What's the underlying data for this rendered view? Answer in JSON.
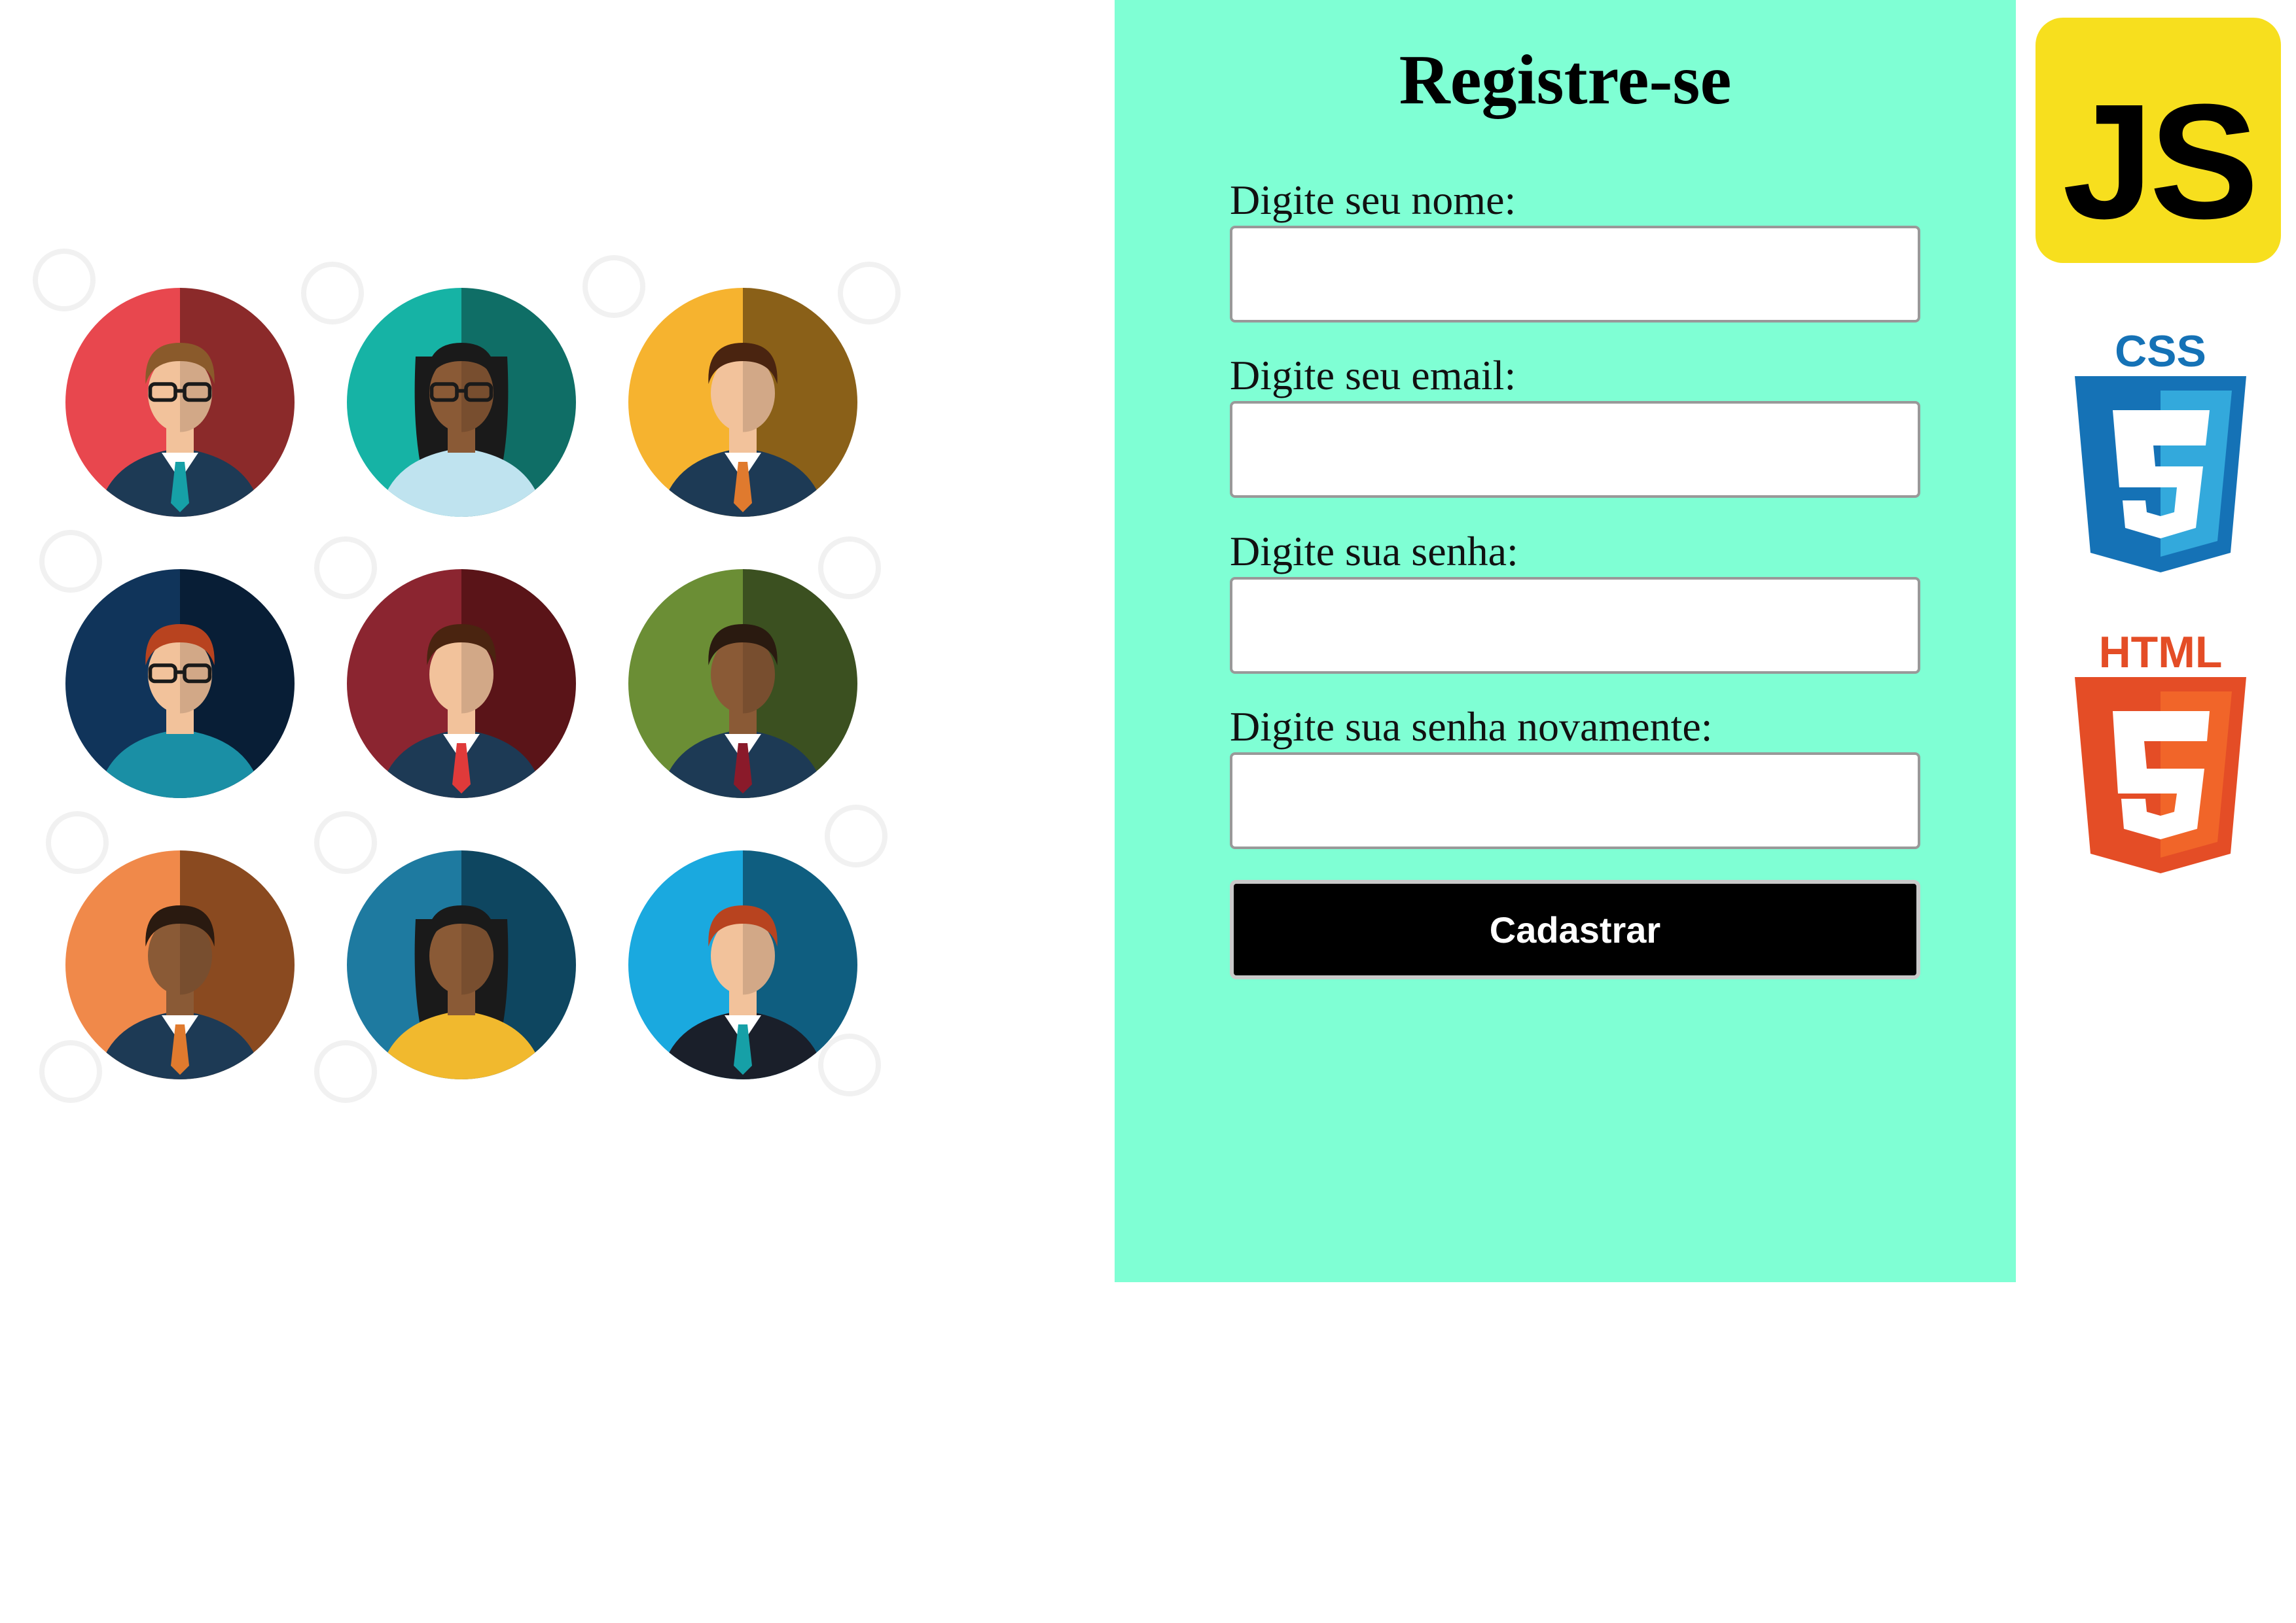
{
  "form": {
    "title": "Registre-se",
    "fields": [
      {
        "label": "Digite seu nome:",
        "value": ""
      },
      {
        "label": "Digite seu email:",
        "value": ""
      },
      {
        "label": "Digite sua senha:",
        "value": ""
      },
      {
        "label": "Digite sua senha novamente:",
        "value": ""
      }
    ],
    "submit_label": "Cadastrar"
  },
  "logos": {
    "js": "JS",
    "css": "CSS",
    "html": "HTML"
  },
  "colors": {
    "panel_bg": "#7fffd4",
    "button_bg": "#000000",
    "js_yellow": "#f7df1e",
    "css_blue": "#1572b6",
    "css_blue_light": "#33a9dc",
    "html_orange": "#e44d26",
    "html_orange_light": "#f16529"
  },
  "avatars": [
    {
      "icon": "man-glasses-avatar-icon",
      "bg": "#e8474e",
      "bg_dark": "#8b2a2a",
      "hair": "#8a5a2b",
      "top": "#1d3a55",
      "tie": "#16a0a7",
      "skin": "#f2c29b",
      "glasses": true,
      "long_hair": false
    },
    {
      "icon": "woman-glasses-avatar-icon",
      "bg": "#16b3a5",
      "bg_dark": "#0f6e66",
      "hair": "#1a1a1a",
      "top": "#bfe3ef",
      "tie": "",
      "skin": "#8a5a36",
      "glasses": true,
      "long_hair": true
    },
    {
      "icon": "man-avatar-icon",
      "bg": "#f6b32f",
      "bg_dark": "#8a6018",
      "hair": "#4a2410",
      "top": "#1d3a55",
      "tie": "#e07a2e",
      "skin": "#f2c29b",
      "glasses": false,
      "long_hair": false
    },
    {
      "icon": "woman-glasses-avatar-icon",
      "bg": "#10345a",
      "bg_dark": "#081e36",
      "hair": "#b8431f",
      "top": "#1a8fa5",
      "tie": "",
      "skin": "#f2c29b",
      "glasses": true,
      "long_hair": false
    },
    {
      "icon": "man-avatar-icon",
      "bg": "#8b2530",
      "bg_dark": "#5a1418",
      "hair": "#4a2410",
      "top": "#1d3a55",
      "tie": "#e03a3a",
      "skin": "#f2c29b",
      "glasses": false,
      "long_hair": false
    },
    {
      "icon": "man-avatar-icon",
      "bg": "#6b8e35",
      "bg_dark": "#3b5020",
      "hair": "#2a1a10",
      "top": "#1d3a55",
      "tie": "#8a1a2a",
      "skin": "#8a5a36",
      "glasses": false,
      "long_hair": false
    },
    {
      "icon": "man-avatar-icon",
      "bg": "#f0894a",
      "bg_dark": "#8a4a20",
      "hair": "#2a1a10",
      "top": "#1d3a55",
      "tie": "#e07a2e",
      "skin": "#8a5a36",
      "glasses": false,
      "long_hair": false
    },
    {
      "icon": "woman-avatar-icon",
      "bg": "#1e7aa0",
      "bg_dark": "#0e4660",
      "hair": "#1a1a1a",
      "top": "#f1b92e",
      "tie": "",
      "skin": "#8a5a36",
      "glasses": false,
      "long_hair": true
    },
    {
      "icon": "man-avatar-icon",
      "bg": "#1aa9df",
      "bg_dark": "#0f5e80",
      "hair": "#b8431f",
      "top": "#1a1f2a",
      "tie": "#16a0a7",
      "skin": "#f2c29b",
      "glasses": false,
      "long_hair": false
    }
  ]
}
